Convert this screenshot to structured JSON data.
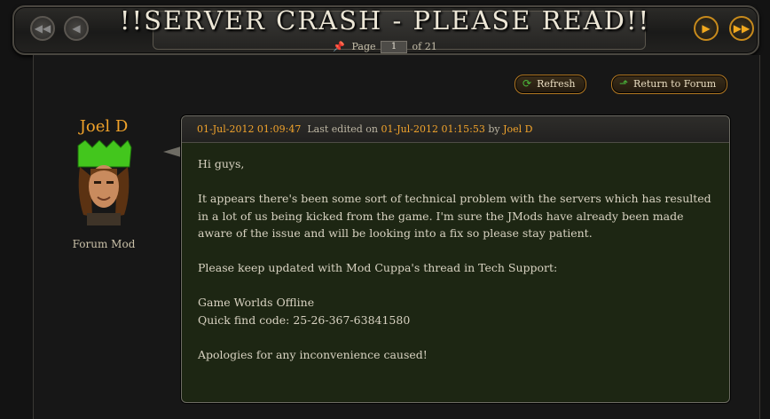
{
  "thread": {
    "title": "!!SERVER CRASH - PLEASE READ!!",
    "pager": {
      "label_before": "Page",
      "current_page": "1",
      "label_after": "of 21"
    }
  },
  "actions": {
    "refresh_label": "Refresh",
    "return_label": "Return to Forum"
  },
  "author": {
    "name": "Joel D",
    "role": "Forum Mod"
  },
  "post": {
    "posted_at": "01-Jul-2012 01:09:47",
    "edited_prefix": "Last edited on",
    "edited_at": "01-Jul-2012 01:15:53",
    "edited_by_prefix": "by",
    "edited_by": "Joel D",
    "paragraphs": [
      "Hi guys,",
      "It appears there's been some sort of technical problem with the servers which has resulted in a lot of us being kicked from the game. I'm sure the JMods have already been made aware of the issue and will be looking into a fix so please stay patient.",
      "Please keep updated with Mod Cuppa's thread in Tech Support:",
      "Game Worlds Offline",
      "Quick find code: 25-26-367-63841580",
      "Apologies for any inconvenience caused!"
    ]
  },
  "colors": {
    "accent": "#f2a42c",
    "post_background": "#1d2613",
    "page_background": "#131313"
  },
  "icons": {
    "first": "double-left-arrow-icon",
    "prev": "left-arrow-icon",
    "next": "right-arrow-icon",
    "last": "double-right-arrow-icon",
    "pin": "pin-icon",
    "refresh": "refresh-icon",
    "return": "up-arrow-icon"
  }
}
